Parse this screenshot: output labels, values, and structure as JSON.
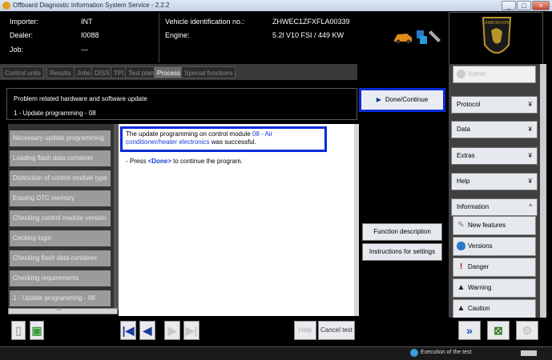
{
  "window": {
    "title": "Offboard Diagnostic Information System Service - 2.2.2",
    "buttons": [
      "_",
      "□",
      "×"
    ]
  },
  "header": {
    "importer_label": "Importer:",
    "importer_value": "INT",
    "dealer_label": "Dealer:",
    "dealer_value": "I0088",
    "job_label": "Job:",
    "job_value": "---",
    "vin_label": "Vehicle identification no.:",
    "vin_value": "ZHWEC1ZFXFLA00339",
    "engine_label": "Engine:",
    "engine_value": "5.2l V10 FSI / 449 KW",
    "logo_text": "LAMBORGHINI"
  },
  "tabs": [
    "Control units",
    "Results",
    "Jobs",
    "DISS",
    "TPI",
    "Test plan",
    "Process",
    "Special functions"
  ],
  "active_tab": "Process",
  "info": {
    "line1": "Problem related hardware and software update",
    "line2": "1 - Update programming - 08"
  },
  "done_button": "Done/Continue",
  "steps": [
    "Necessary update programming",
    "Loading flash data container",
    "Distinction of control module type",
    "Erasing DTC memory",
    "Checking control module version",
    "Cecking login",
    "Checking flash data container",
    "Checking requirements",
    "1 - Update programming - 08"
  ],
  "message": {
    "prefix": "The update programming on control module ",
    "module": "08 - Air conditioner/heater electronics",
    "suffix": " was successful.",
    "press_prefix": "- Press ",
    "press_key": "<Done>",
    "press_suffix": " to continue the program."
  },
  "mid_buttons": {
    "function_description": "Function description",
    "instructions": "Instructions for settings"
  },
  "sidebar": {
    "admin": "Admin",
    "sections": [
      {
        "label": "Protocol",
        "chevron": "¥"
      },
      {
        "label": "Data",
        "chevron": "¥"
      },
      {
        "label": "Extras",
        "chevron": "¥"
      },
      {
        "label": "Help",
        "chevron": "¥"
      },
      {
        "label": "Information",
        "chevron": "^"
      }
    ],
    "info_items": [
      "New features",
      "Versions",
      "Danger",
      "Warning",
      "Caution"
    ]
  },
  "bottom": {
    "help": "Help",
    "cancel": "Cancel test",
    "hscroll_mark": "III"
  },
  "status": {
    "text": "Execution of the test"
  },
  "colors": {
    "highlight_border": "#0a2bd6",
    "link_blue": "#1a3bd6"
  }
}
